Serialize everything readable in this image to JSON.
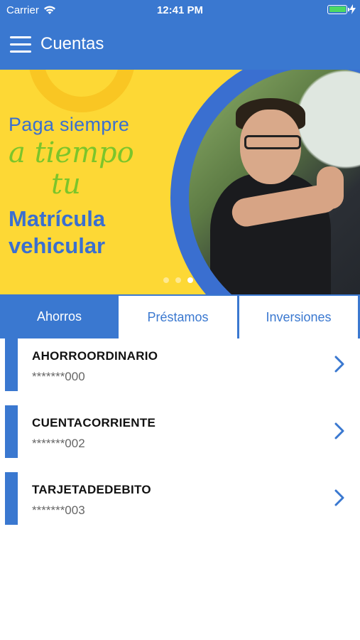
{
  "status_bar": {
    "carrier": "Carrier",
    "time": "12:41 PM"
  },
  "nav": {
    "title": "Cuentas",
    "menu_icon": "hamburger-menu-icon"
  },
  "banner": {
    "line1": "Paga siempre",
    "line2": "a tiempo",
    "line3": "tu",
    "line4": "Matrícula",
    "line5": "vehicular",
    "slides_total": 3,
    "active_slide": 3
  },
  "tabs": [
    {
      "label": "Ahorros",
      "active": true
    },
    {
      "label": "Préstamos",
      "active": false
    },
    {
      "label": "Inversiones",
      "active": false
    }
  ],
  "accounts": [
    {
      "name": "AHORROORDINARIO",
      "number": "*******000"
    },
    {
      "name": "CUENTACORRIENTE",
      "number": "*******002"
    },
    {
      "name": "TARJETADEDEBITO",
      "number": "*******003"
    }
  ],
  "colors": {
    "primary": "#3a78d0",
    "banner_yellow": "#fdd835",
    "accent_green": "#7cc52a",
    "battery_green": "#4cd964"
  }
}
